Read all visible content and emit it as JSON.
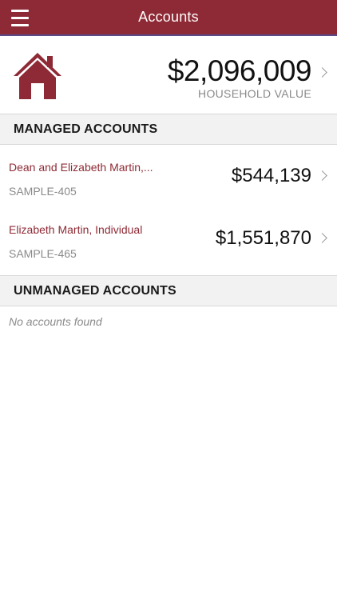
{
  "nav": {
    "title": "Accounts"
  },
  "household": {
    "value": "$2,096,009",
    "label": "HOUSEHOLD VALUE"
  },
  "managed": {
    "header": "MANAGED ACCOUNTS",
    "accounts": [
      {
        "name": "Dean and Elizabeth Martin,...",
        "id": "SAMPLE-405",
        "value": "$544,139"
      },
      {
        "name": "Elizabeth Martin, Individual",
        "id": "SAMPLE-465",
        "value": "$1,551,870"
      }
    ]
  },
  "unmanaged": {
    "header": "UNMANAGED ACCOUNTS",
    "empty_text": "No accounts found"
  },
  "colors": {
    "brand": "#8e2a35",
    "header_bg": "#f2f2f2",
    "muted_text": "#8a8a8a"
  },
  "icons": {
    "menu": "hamburger-menu-icon",
    "household": "home-icon",
    "disclosure": "chevron-right-icon"
  }
}
